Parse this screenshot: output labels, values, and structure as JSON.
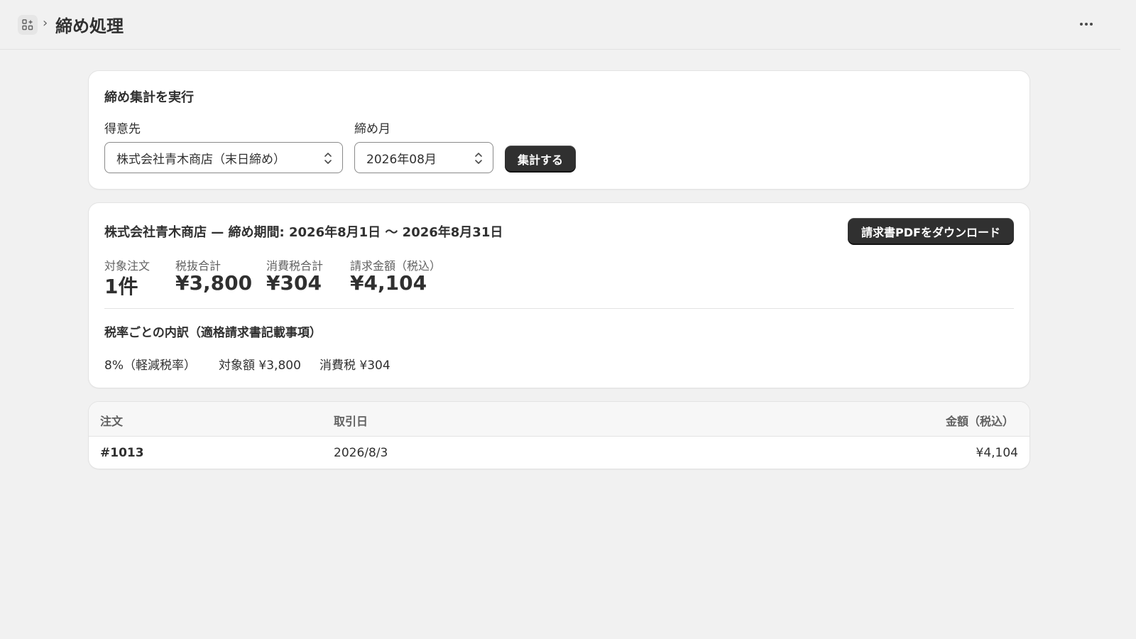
{
  "header": {
    "title": "締め処理"
  },
  "run_card": {
    "title": "締め集計を実行",
    "customer_label": "得意先",
    "customer_value": "株式会社青木商店（末日締め）",
    "month_label": "締め月",
    "month_value": "2026年08月",
    "run_button": "集計する"
  },
  "summary_card": {
    "title": "株式会社青木商店 — 締め期間: 2026年8月1日 〜 2026年8月31日",
    "download_button": "請求書PDFをダウンロード",
    "stats": [
      {
        "label": "対象注文",
        "value": "1件"
      },
      {
        "label": "税抜合計",
        "value": "¥3,800"
      },
      {
        "label": "消費税合計",
        "value": "¥304"
      },
      {
        "label": "請求金額（税込）",
        "value": "¥4,104"
      }
    ],
    "breakdown_title": "税率ごとの内訳（適格請求書記載事項）",
    "breakdown": {
      "rate": "8%（軽減税率）",
      "taxable": "対象額 ¥3,800",
      "tax": "消費税 ¥304"
    }
  },
  "orders_table": {
    "columns": [
      "注文",
      "取引日",
      "金額（税込）"
    ],
    "rows": [
      {
        "order": "#1013",
        "date": "2026/8/3",
        "amount": "¥4,104"
      }
    ]
  }
}
